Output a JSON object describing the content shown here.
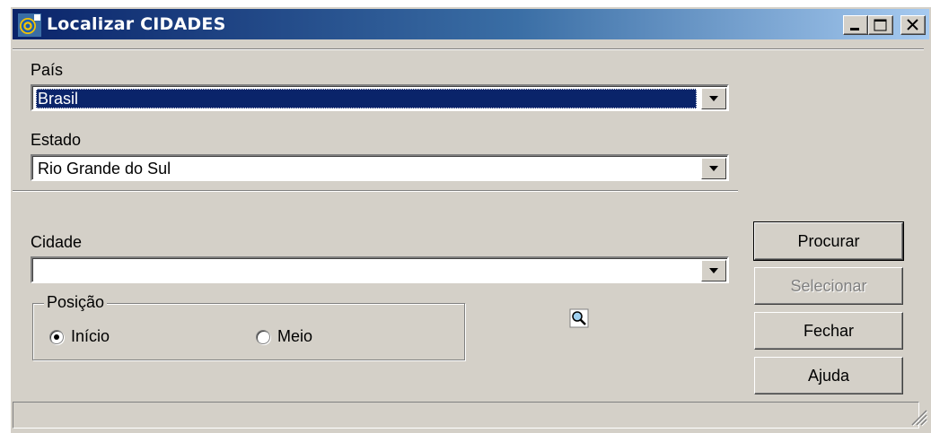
{
  "window": {
    "title": "Localizar CIDADES",
    "controls": {
      "minimize": "minimize",
      "maximize": "maximize",
      "close": "close"
    }
  },
  "form": {
    "pais": {
      "label": "País",
      "value": "Brasil"
    },
    "estado": {
      "label": "Estado",
      "value": "Rio Grande do Sul"
    },
    "cidade": {
      "label": "Cidade",
      "value": ""
    },
    "posicao": {
      "legend": "Posição",
      "options": [
        {
          "label": "Início",
          "checked": true
        },
        {
          "label": "Meio",
          "checked": false
        }
      ]
    }
  },
  "buttons": {
    "procurar": "Procurar",
    "selecionar": "Selecionar",
    "fechar": "Fechar",
    "ajuda": "Ajuda"
  },
  "status": {
    "text": ""
  },
  "colors": {
    "titlebar_start": "#0a246a",
    "titlebar_end": "#a6caf0",
    "face": "#d4d0c8",
    "selection": "#0a246a"
  },
  "icons": [
    "app-icon",
    "search-icon",
    "resize-grip-icon"
  ]
}
